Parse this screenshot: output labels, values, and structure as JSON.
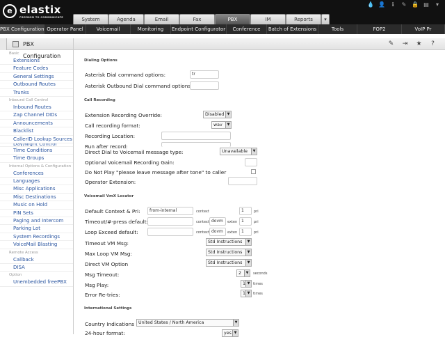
{
  "header": {
    "logo_name": "elastix",
    "logo_mark": "e",
    "logo_tagline": "FREEDOM TO COMMUNICATE",
    "tabs": [
      {
        "label": "System"
      },
      {
        "label": "Agenda"
      },
      {
        "label": "Email"
      },
      {
        "label": "Fax"
      },
      {
        "label": "PBX"
      },
      {
        "label": "IM"
      },
      {
        "label": "Reports"
      }
    ],
    "active_tab": "PBX",
    "more": "▾",
    "icons": [
      "water-drop-icon",
      "user-icon",
      "info-icon",
      "pencil-icon",
      "lock-icon",
      "clipboard-icon",
      "chevron-down-icon"
    ]
  },
  "subnav": [
    "PBX Configuration",
    "Operator Panel",
    "Voicemail",
    "Monitoring",
    "Endpoint Configurator",
    "Conference",
    "Batch of Extensions",
    "Tools",
    "FOP2",
    "VoIP Pr"
  ],
  "sidebar": {
    "title": "PBX Configuration",
    "sections": [
      {
        "name": "Basic",
        "items": [
          "Extensions",
          "Feature Codes",
          "General Settings",
          "Outbound Routes",
          "Trunks"
        ]
      },
      {
        "name": "Inbound Call Control",
        "items": [
          "Inbound Routes",
          "Zap Channel DIDs",
          "Announcements",
          "Blacklist",
          "CallerID Lookup Sources",
          "Day/Night Control",
          "Time Conditions",
          "Time Groups"
        ]
      },
      {
        "name": "Internal Options & Configuration",
        "items": [
          "Conferences",
          "Languages",
          "Misc Applications",
          "Misc Destinations",
          "Music on Hold",
          "PIN Sets",
          "Paging and Intercom",
          "Parking Lot",
          "System Recordings",
          "VoiceMail Blasting"
        ]
      },
      {
        "name": "Remote Access",
        "items": [
          "Callback",
          "DISA"
        ]
      },
      {
        "name": "Option",
        "items": [
          "Unembedded freePBX"
        ]
      }
    ]
  },
  "main": {
    "toolbar_icons": [
      "edit-icon",
      "pin-icon",
      "star-icon",
      "help-icon"
    ],
    "dialing": {
      "heading": "Dialing Options",
      "dial_label": "Asterisk Dial command options:",
      "dial_value": "tr",
      "outbound_label": "Asterisk Outbound Dial command options:",
      "outbound_value": ""
    },
    "recording": {
      "heading": "Call Recording",
      "override_label": "Extension Recording Override:",
      "override_value": "Disabled",
      "format_label": "Call recording format:",
      "format_value": "wav",
      "location_label": "Recording Location:",
      "after_label": "Run after record:",
      "direct_label": "Direct Dial to Voicemail message type:",
      "direct_value": "Unavailable",
      "gain_label": "Optional Voicemail Recording Gain:",
      "noplay_label": "Do Not Play \"please leave message after tone\" to caller",
      "operator_label": "Operator Extension:"
    },
    "vmx": {
      "heading": "Voicemail VmX Locator",
      "context_word": "context",
      "exten_word": "exten",
      "pri_word": "pri",
      "seconds_word": "seconds",
      "times_word": "times",
      "default_label": "Default Context & Pri:",
      "default_context": "from-internal",
      "default_pri": "1",
      "timeout_label": "Timeout/#-press default:",
      "timeout_context": "dovm",
      "timeout_exten": "1",
      "timeout_pri": "1",
      "loop_label": "Loop Exceed default:",
      "loop_context": "dovm",
      "loop_exten": "1",
      "loop_pri": "1",
      "tvm_label": "Timeout VM Msg:",
      "tvm_value": "Std Instructions",
      "maxloop_label": "Max Loop VM Msg:",
      "maxloop_value": "Std Instructions",
      "direct_label": "Direct VM Option",
      "direct_value": "Std Instructions",
      "msgtimeout_label": "Msg Timeout:",
      "msgtimeout_value": "2",
      "msgplay_label": "Msg Play:",
      "msgplay_value": "1",
      "retries_label": "Error Re-tries:",
      "retries_value": "1"
    },
    "intl": {
      "heading": "International Settings",
      "country_label": "Country Indications",
      "country_value": "United States / North America",
      "hour_label": "24-hour format:",
      "hour_value": "yes"
    }
  }
}
